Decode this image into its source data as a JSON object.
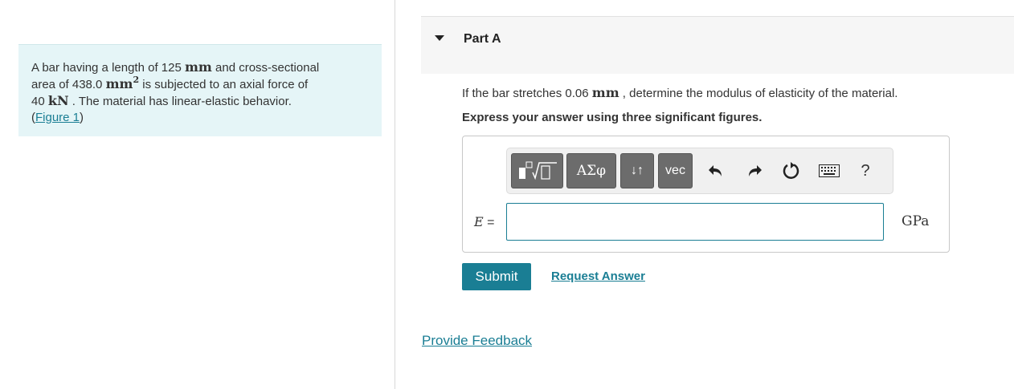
{
  "problem": {
    "line1_pre": "A bar having a length of 125",
    "line1_unit": "mm",
    "line1_post": "and cross-sectional",
    "line2_pre": "area of 438.0",
    "line2_unit": "mm",
    "line2_exp": "2",
    "line2_post": "is subjected to an axial force of",
    "line3_value": "40",
    "line3_unit": "kN",
    "line3_post": ". The material has linear-elastic behavior.",
    "figure_open": "(",
    "figure_link": "Figure 1",
    "figure_close": ")"
  },
  "part": {
    "title": "Part A",
    "question_pre": "If the bar stretches 0.06",
    "question_unit": "mm",
    "question_post": ", determine the modulus of elasticity of the material.",
    "instruction": "Express your answer using three significant figures."
  },
  "toolbar": {
    "greek_label": "ΑΣφ",
    "arrows_label": "↓↑",
    "vec_label": "vec",
    "help_label": "?"
  },
  "answer": {
    "variable": "E",
    "equals": "=",
    "value": "",
    "units": "GPa"
  },
  "actions": {
    "submit_label": "Submit",
    "request_label": "Request Answer",
    "feedback_label": "Provide Feedback"
  },
  "colors": {
    "accent": "#1a7e94",
    "problem_bg": "#e5f5f7",
    "toolbar_button": "#6c6c6c"
  }
}
